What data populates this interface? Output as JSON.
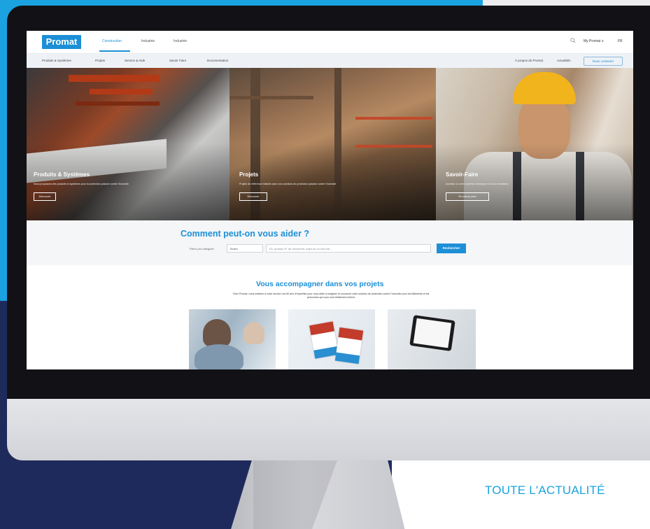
{
  "brand": {
    "logo_text": "Promat",
    "primary": "#1d8fd6",
    "cyan": "#1aa3e0",
    "navy": "#1f2a5c"
  },
  "header": {
    "tabs": [
      {
        "label": "Construction"
      },
      {
        "label": "Industrie"
      },
      {
        "label": "Industrie"
      }
    ],
    "account_label": "My Promat ∨",
    "lang_label": "FR",
    "search_icon": "search-icon"
  },
  "nav": {
    "items": [
      {
        "label": "Produits & Systèmes"
      },
      {
        "label": "Projets"
      },
      {
        "label": "Service & Aide"
      },
      {
        "label": "Savoir Faire"
      },
      {
        "label": "Documentation"
      }
    ],
    "right": [
      {
        "label": "À propos de Promat"
      },
      {
        "label": "Actualités"
      }
    ],
    "contact_label": "Nous contacter"
  },
  "hero": [
    {
      "title": "Produits & Systèmes",
      "desc": "Nous proposons des produits et systèmes pour la protection passive contre l’incendie",
      "button": "Découvrir"
    },
    {
      "title": "Projets",
      "desc": "Projets de référence réalisés avec nos solutions de protection passive contre l’incendie",
      "button": "Découvrir"
    },
    {
      "title": "Savoir-Faire",
      "desc": "Accédez à notre expertise technique et à nos formations",
      "button": "En savoir plus"
    }
  ],
  "help": {
    "title": "Comment peut-on vous aider ?",
    "filter_label": "Filtrer par catégorie",
    "filter_value": "Toutes",
    "search_placeholder": "Ex: produit, N° de document, sujet ou un mot-clé...",
    "search_button": "Rechercher"
  },
  "accompany": {
    "title": "Vous accompagner dans vos projets",
    "desc": "Chez Promat, nous mettons à votre service nos 60 ans d’expertise pour vous aider à imaginer et concevoir votre solution de protection contre l’incendie pour les bâtiments et les personnes qui vous sont réellement chères"
  },
  "footer_link": "TOUTE L'ACTUALITÉ"
}
